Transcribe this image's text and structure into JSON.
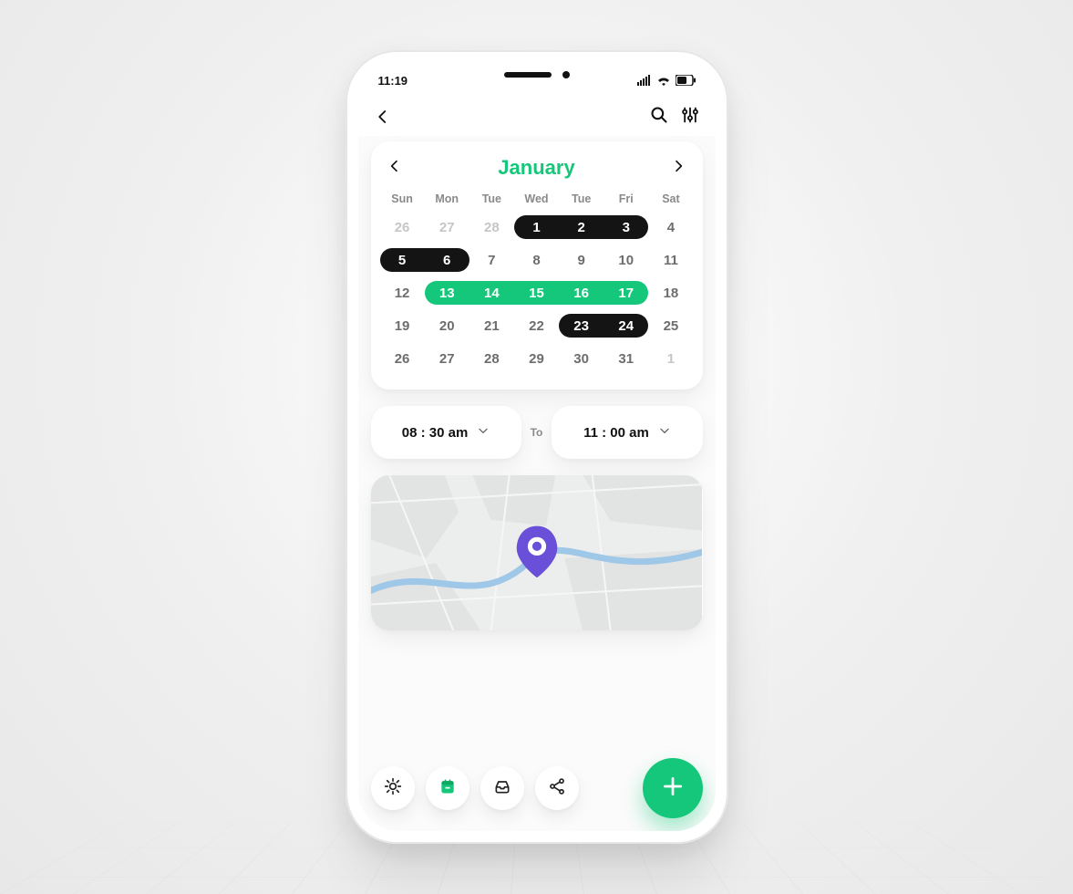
{
  "statusbar": {
    "time": "11:19"
  },
  "calendar": {
    "month": "January",
    "dow": [
      "Sun",
      "Mon",
      "Tue",
      "Wed",
      "Tue",
      "Fri",
      "Sat"
    ],
    "weeks": [
      [
        {
          "d": "26",
          "muted": true
        },
        {
          "d": "27",
          "muted": true
        },
        {
          "d": "28",
          "muted": true
        },
        {
          "d": "1",
          "on": "black"
        },
        {
          "d": "2",
          "on": "black"
        },
        {
          "d": "3",
          "on": "black"
        },
        {
          "d": "4"
        }
      ],
      [
        {
          "d": "5",
          "on": "black"
        },
        {
          "d": "6",
          "on": "black"
        },
        {
          "d": "7"
        },
        {
          "d": "8"
        },
        {
          "d": "9"
        },
        {
          "d": "10"
        },
        {
          "d": "11"
        }
      ],
      [
        {
          "d": "12"
        },
        {
          "d": "13",
          "on": "green"
        },
        {
          "d": "14",
          "on": "green"
        },
        {
          "d": "15",
          "on": "green"
        },
        {
          "d": "16",
          "on": "green"
        },
        {
          "d": "17",
          "on": "green"
        },
        {
          "d": "18"
        }
      ],
      [
        {
          "d": "19"
        },
        {
          "d": "20"
        },
        {
          "d": "21"
        },
        {
          "d": "22"
        },
        {
          "d": "23",
          "on": "black"
        },
        {
          "d": "24",
          "on": "black"
        },
        {
          "d": "25"
        }
      ],
      [
        {
          "d": "26"
        },
        {
          "d": "27"
        },
        {
          "d": "28"
        },
        {
          "d": "29"
        },
        {
          "d": "30"
        },
        {
          "d": "31"
        },
        {
          "d": "1",
          "muted": true
        }
      ]
    ],
    "ranges": [
      {
        "week": 0,
        "start": 3,
        "end": 5,
        "color": "black"
      },
      {
        "week": 1,
        "start": 0,
        "end": 1,
        "color": "black"
      },
      {
        "week": 2,
        "start": 1,
        "end": 5,
        "color": "green"
      },
      {
        "week": 3,
        "start": 4,
        "end": 5,
        "color": "black"
      }
    ]
  },
  "time": {
    "from": "08 : 30 am",
    "to_label": "To",
    "to": "11 : 00 am"
  },
  "colors": {
    "accent": "#15c77a",
    "pin": "#6a4fd8"
  }
}
